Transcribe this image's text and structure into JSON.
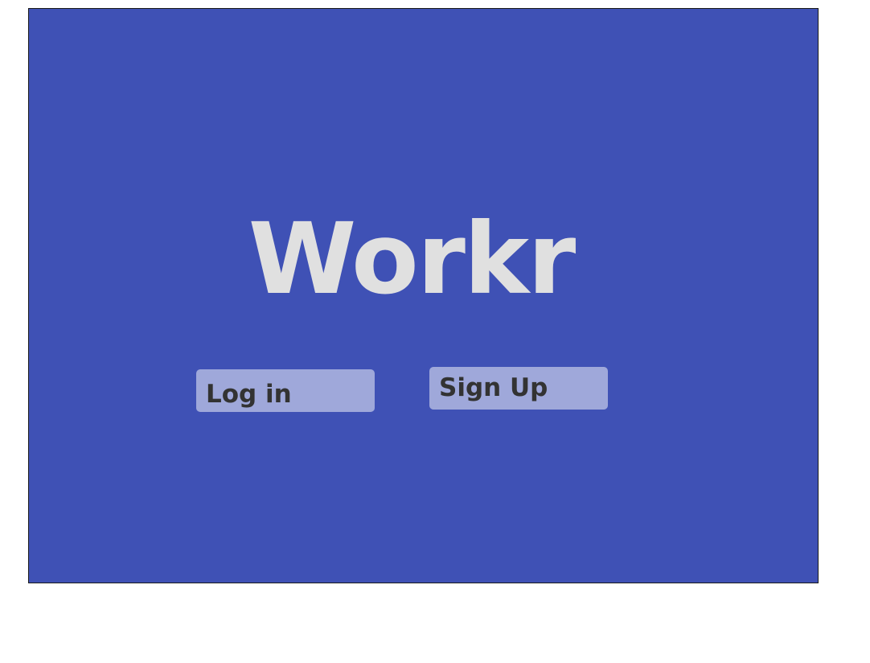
{
  "app": {
    "title": "Workr"
  },
  "actions": {
    "login_label": "Log in",
    "signup_label": "Sign Up"
  },
  "colors": {
    "background": "#3f51b5",
    "title_text": "#e0e0e0",
    "button_background": "#9fa8da",
    "button_text": "#333333"
  }
}
